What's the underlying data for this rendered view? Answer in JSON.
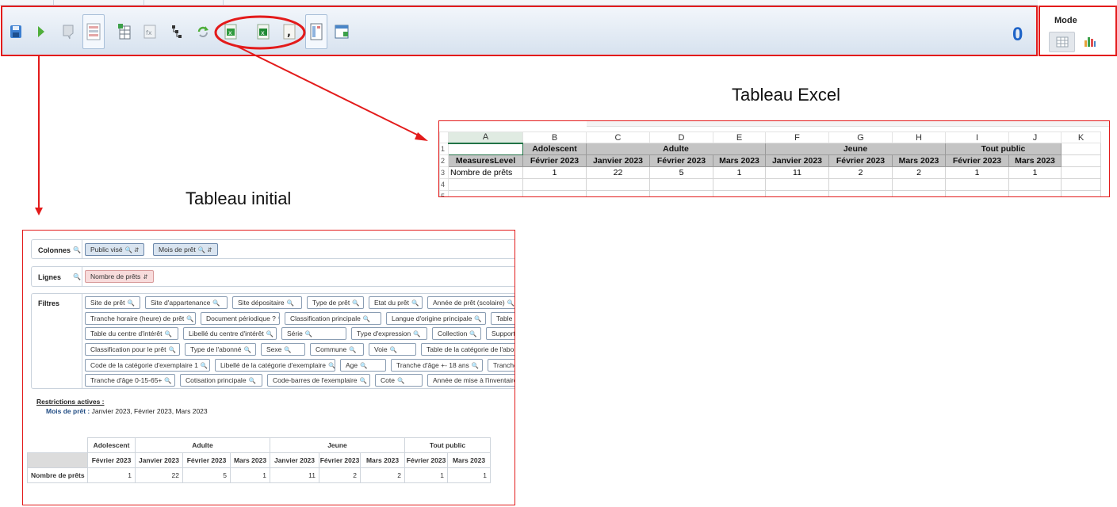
{
  "toolbar": {
    "buttons": [
      "save-icon",
      "play-icon",
      "comment-icon",
      "grid-layout-icon",
      "table-add-icon",
      "formula-icon",
      "hierarchy-icon",
      "refresh-icon",
      "export-excel-icon",
      "export-excel-icon",
      "export-csv-icon",
      "page-layout-icon",
      "new-window-icon"
    ],
    "counter": "0"
  },
  "mode": {
    "title": "Mode"
  },
  "captions": {
    "excel": "Tableau Excel",
    "initial": "Tableau initial"
  },
  "excel": {
    "col_letters": [
      "A",
      "B",
      "C",
      "D",
      "E",
      "F",
      "G",
      "H",
      "I",
      "J",
      "K"
    ],
    "row_numbers": [
      "1",
      "2",
      "3",
      "4",
      "5"
    ],
    "group_row": [
      "",
      "Adolescent",
      "Adulte",
      "Jeune",
      "Tout public"
    ],
    "header_row": [
      "MeasuresLevel",
      "Février 2023",
      "Janvier 2023",
      "Février 2023",
      "Mars 2023",
      "Janvier 2023",
      "Février 2023",
      "Mars 2023",
      "Février 2023",
      "Mars 2023"
    ],
    "data_row": [
      "Nombre de prêts",
      "1",
      "22",
      "5",
      "1",
      "11",
      "2",
      "2",
      "1",
      "1"
    ]
  },
  "pivot_ui": {
    "colonnes_label": "Colonnes",
    "colonnes_chips": [
      "Public visé",
      "Mois de prêt"
    ],
    "lignes_label": "Lignes",
    "lignes_chips": [
      "Nombre de prêts"
    ],
    "filtres_label": "Filtres",
    "filter_rows": [
      [
        "Site de prêt",
        "Site d'appartenance",
        "Site dépositaire",
        "Type de prêt",
        "Etat du prêt",
        "Année de prêt (scolaire)",
        "La"
      ],
      [
        "Tranche horaire (heure) de prêt",
        "Document périodique ?",
        "Classification principale",
        "Langue d'origine principale",
        "Table de"
      ],
      [
        "Table du centre d'intérêt",
        "Libellé du centre d'intérêt",
        "Série",
        "Type d'expression",
        "Collection",
        "Support",
        "N"
      ],
      [
        "Classification pour le prêt",
        "Type de l'abonné",
        "Sexe",
        "Commune",
        "Voie",
        "Table de la catégorie de l'abonné"
      ],
      [
        "Code de la catégorie d'exemplaire 1",
        "Libellé de la catégorie d'exemplaire",
        "Age",
        "Tranche d'âge +- 18 ans",
        "Tranche d"
      ],
      [
        "Tranche d'âge 0-15-65+",
        "Cotisation principale",
        "Code-barres de l'exemplaire",
        "Cote",
        "Année de mise à l'inventaire"
      ]
    ],
    "restrictions_title": "Restrictions actives :",
    "restriction_field": "Mois de prêt :",
    "restriction_values": "Janvier 2023, Février 2023, Mars 2023"
  },
  "pivot_table": {
    "groups": [
      "Adolescent",
      "Adulte",
      "Jeune",
      "Tout public"
    ],
    "months": [
      "Février 2023",
      "Janvier 2023",
      "Février 2023",
      "Mars 2023",
      "Janvier 2023",
      "Février 2023",
      "Mars 2023",
      "Février 2023",
      "Mars 2023"
    ],
    "row_label": "Nombre de prêts",
    "values": [
      "1",
      "22",
      "5",
      "1",
      "11",
      "2",
      "2",
      "1",
      "1"
    ]
  }
}
